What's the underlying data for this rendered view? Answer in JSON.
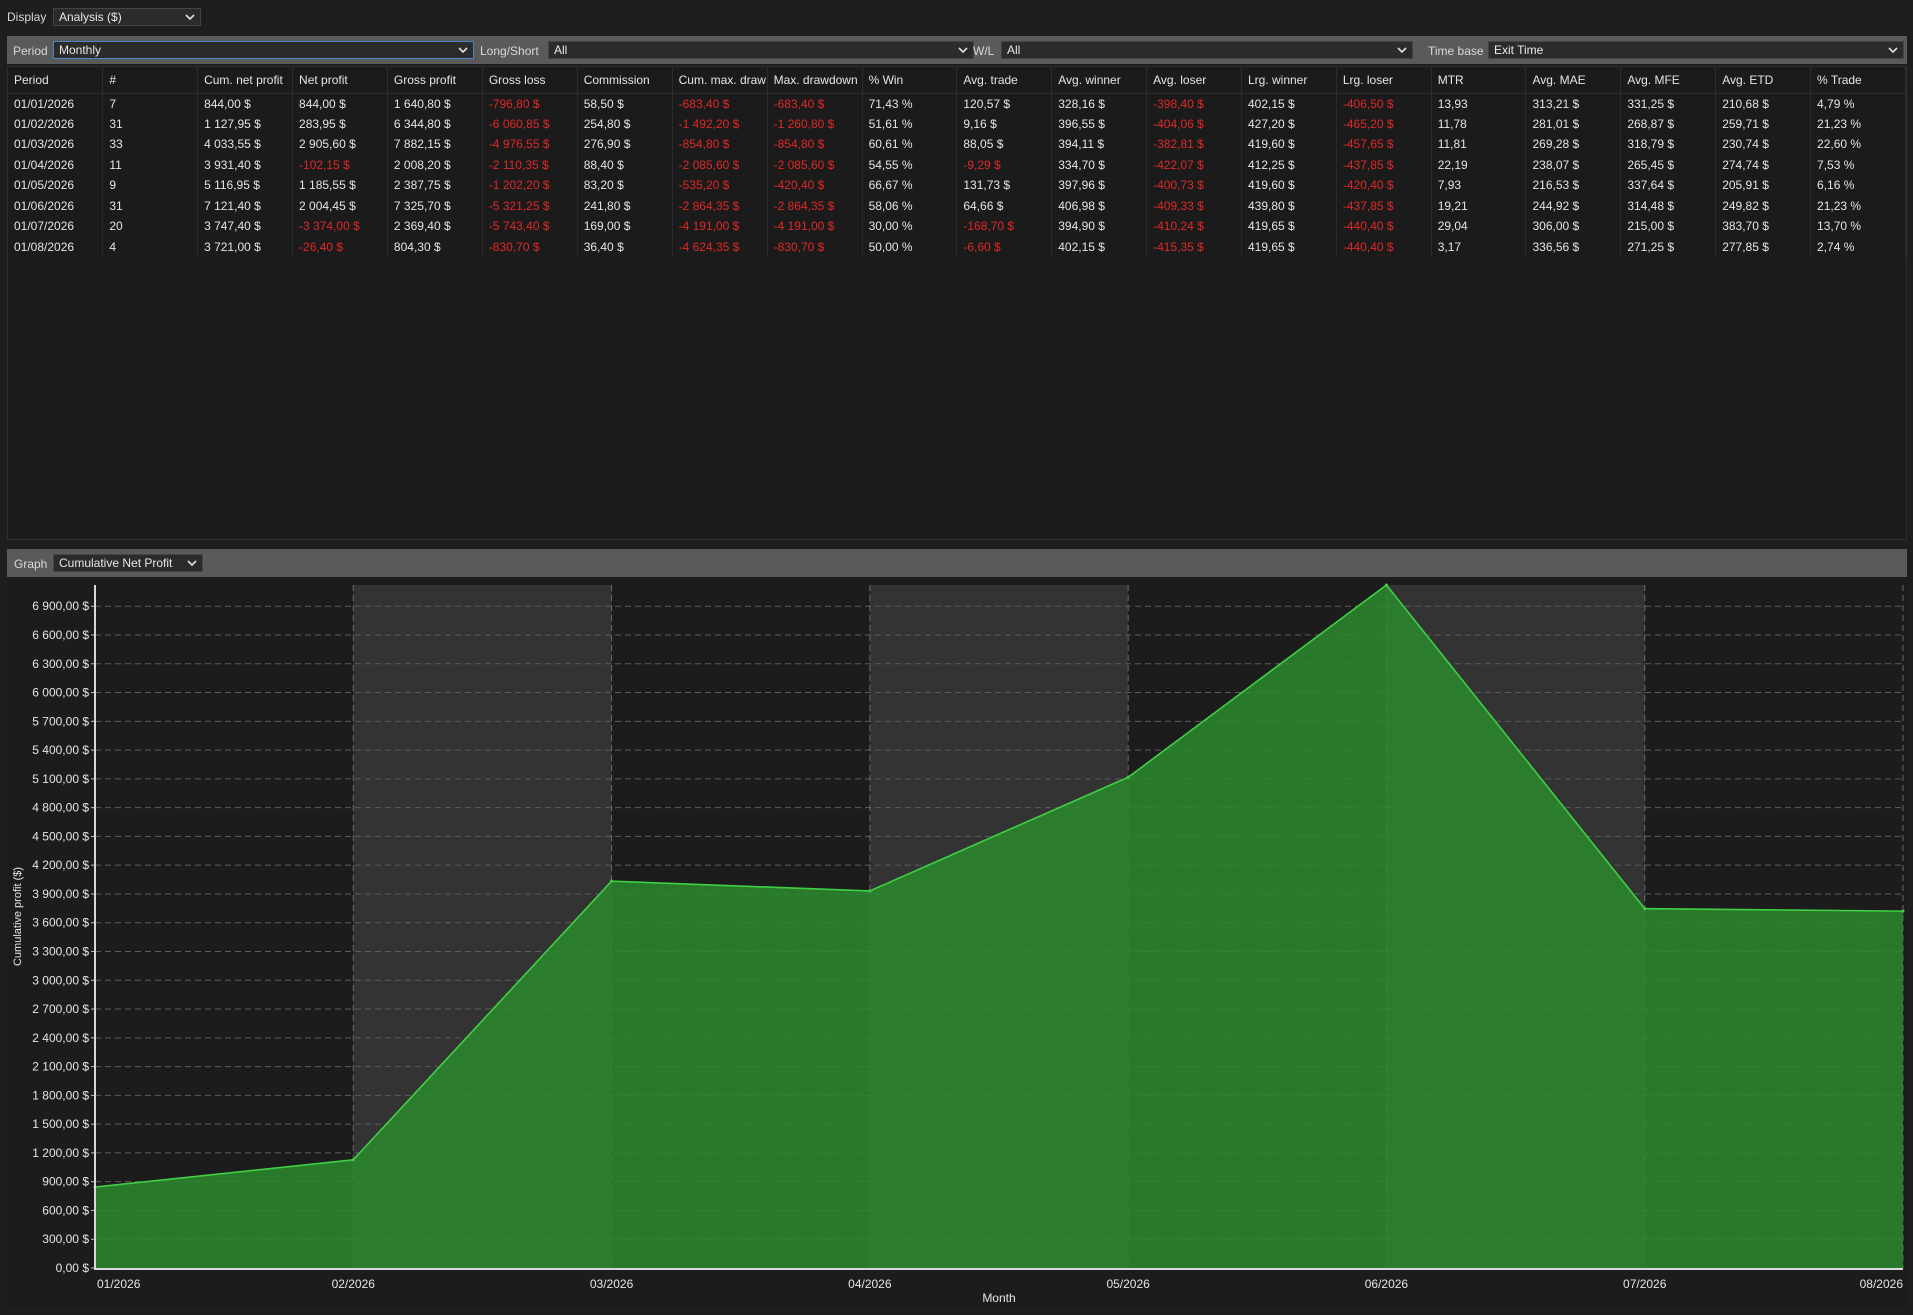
{
  "display": {
    "label": "Display",
    "value": "Analysis ($)"
  },
  "filters": {
    "period": {
      "label": "Period",
      "value": "Monthly"
    },
    "long_short": {
      "label": "Long/Short",
      "value": "All"
    },
    "wl": {
      "label": "W/L",
      "value": "All"
    },
    "time_base": {
      "label": "Time base",
      "value": "Exit Time"
    }
  },
  "table": {
    "columns": [
      "Period",
      "#",
      "Cum. net profit",
      "Net profit",
      "Gross profit",
      "Gross loss",
      "Commission",
      "Cum. max. draw",
      "Max. drawdown",
      "% Win",
      "Avg. trade",
      "Avg. winner",
      "Avg. loser",
      "Lrg. winner",
      "Lrg. loser",
      "MTR",
      "Avg. MAE",
      "Avg. MFE",
      "Avg. ETD",
      "% Trade"
    ],
    "rows": [
      [
        "01/01/2026",
        "7",
        "844,00 $",
        "844,00 $",
        "1 640,80 $",
        "-796,80 $",
        "58,50 $",
        "-683,40 $",
        "-683,40 $",
        "71,43 %",
        "120,57 $",
        "328,16 $",
        "-398,40 $",
        "402,15 $",
        "-406,50 $",
        "13,93",
        "313,21 $",
        "331,25 $",
        "210,68 $",
        "4,79 %"
      ],
      [
        "01/02/2026",
        "31",
        "1 127,95 $",
        "283,95 $",
        "6 344,80 $",
        "-6 060,85 $",
        "254,80 $",
        "-1 492,20 $",
        "-1 260,80 $",
        "51,61 %",
        "9,16 $",
        "396,55 $",
        "-404,06 $",
        "427,20 $",
        "-465,20 $",
        "11,78",
        "281,01 $",
        "268,87 $",
        "259,71 $",
        "21,23 %"
      ],
      [
        "01/03/2026",
        "33",
        "4 033,55 $",
        "2 905,60 $",
        "7 882,15 $",
        "-4 976,55 $",
        "276,90 $",
        "-854,80 $",
        "-854,80 $",
        "60,61 %",
        "88,05 $",
        "394,11 $",
        "-382,81 $",
        "419,60 $",
        "-457,65 $",
        "11,81",
        "269,28 $",
        "318,79 $",
        "230,74 $",
        "22,60 %"
      ],
      [
        "01/04/2026",
        "11",
        "3 931,40 $",
        "-102,15 $",
        "2 008,20 $",
        "-2 110,35 $",
        "88,40 $",
        "-2 085,60 $",
        "-2 085,60 $",
        "54,55 %",
        "-9,29 $",
        "334,70 $",
        "-422,07 $",
        "412,25 $",
        "-437,85 $",
        "22,19",
        "238,07 $",
        "265,45 $",
        "274,74 $",
        "7,53 %"
      ],
      [
        "01/05/2026",
        "9",
        "5 116,95 $",
        "1 185,55 $",
        "2 387,75 $",
        "-1 202,20 $",
        "83,20 $",
        "-535,20 $",
        "-420,40 $",
        "66,67 %",
        "131,73 $",
        "397,96 $",
        "-400,73 $",
        "419,60 $",
        "-420,40 $",
        "7,93",
        "216,53 $",
        "337,64 $",
        "205,91 $",
        "6,16 %"
      ],
      [
        "01/06/2026",
        "31",
        "7 121,40 $",
        "2 004,45 $",
        "7 325,70 $",
        "-5 321,25 $",
        "241,80 $",
        "-2 864,35 $",
        "-2 864,35 $",
        "58,06 %",
        "64,66 $",
        "406,98 $",
        "-409,33 $",
        "439,80 $",
        "-437,85 $",
        "19,21",
        "244,92 $",
        "314,48 $",
        "249,82 $",
        "21,23 %"
      ],
      [
        "01/07/2026",
        "20",
        "3 747,40 $",
        "-3 374,00 $",
        "2 369,40 $",
        "-5 743,40 $",
        "169,00 $",
        "-4 191,00 $",
        "-4 191,00 $",
        "30,00 %",
        "-168,70 $",
        "394,90 $",
        "-410,24 $",
        "419,65 $",
        "-440,40 $",
        "29,04",
        "306,00 $",
        "215,00 $",
        "383,70 $",
        "13,70 %"
      ],
      [
        "01/08/2026",
        "4",
        "3 721,00 $",
        "-26,40 $",
        "804,30 $",
        "-830,70 $",
        "36,40 $",
        "-4 624,35 $",
        "-830,70 $",
        "50,00 %",
        "-6,60 $",
        "402,15 $",
        "-415,35 $",
        "419,65 $",
        "-440,40 $",
        "3,17",
        "336,56 $",
        "271,25 $",
        "277,85 $",
        "2,74 %"
      ]
    ]
  },
  "graph": {
    "label": "Graph",
    "value": "Cumulative Net Profit"
  },
  "chart_data": {
    "type": "area",
    "xlabel": "Month",
    "ylabel": "Cumulative profit ($)",
    "x": [
      "01/2026",
      "02/2026",
      "03/2026",
      "04/2026",
      "05/2026",
      "06/2026",
      "07/2026",
      "08/2026"
    ],
    "series": [
      {
        "values": [
          844.0,
          1127.95,
          4033.55,
          3931.4,
          5116.95,
          7121.4,
          3747.4,
          3721.0
        ]
      }
    ],
    "ylim": [
      0,
      7121.4
    ],
    "yticks": [
      "0,00 $",
      "300,00 $",
      "600,00 $",
      "900,00 $",
      "1 200,00 $",
      "1 500,00 $",
      "1 800,00 $",
      "2 100,00 $",
      "2 400,00 $",
      "2 700,00 $",
      "3 000,00 $",
      "3 300,00 $",
      "3 600,00 $",
      "3 900,00 $",
      "4 200,00 $",
      "4 500,00 $",
      "4 800,00 $",
      "5 100,00 $",
      "5 400,00 $",
      "5 700,00 $",
      "6 000,00 $",
      "6 300,00 $",
      "6 600,00 $",
      "6 900,00 $"
    ],
    "grid": true,
    "colors": {
      "fill": "#2b8a2e",
      "line": "#3fd043",
      "band": "#333333"
    }
  }
}
